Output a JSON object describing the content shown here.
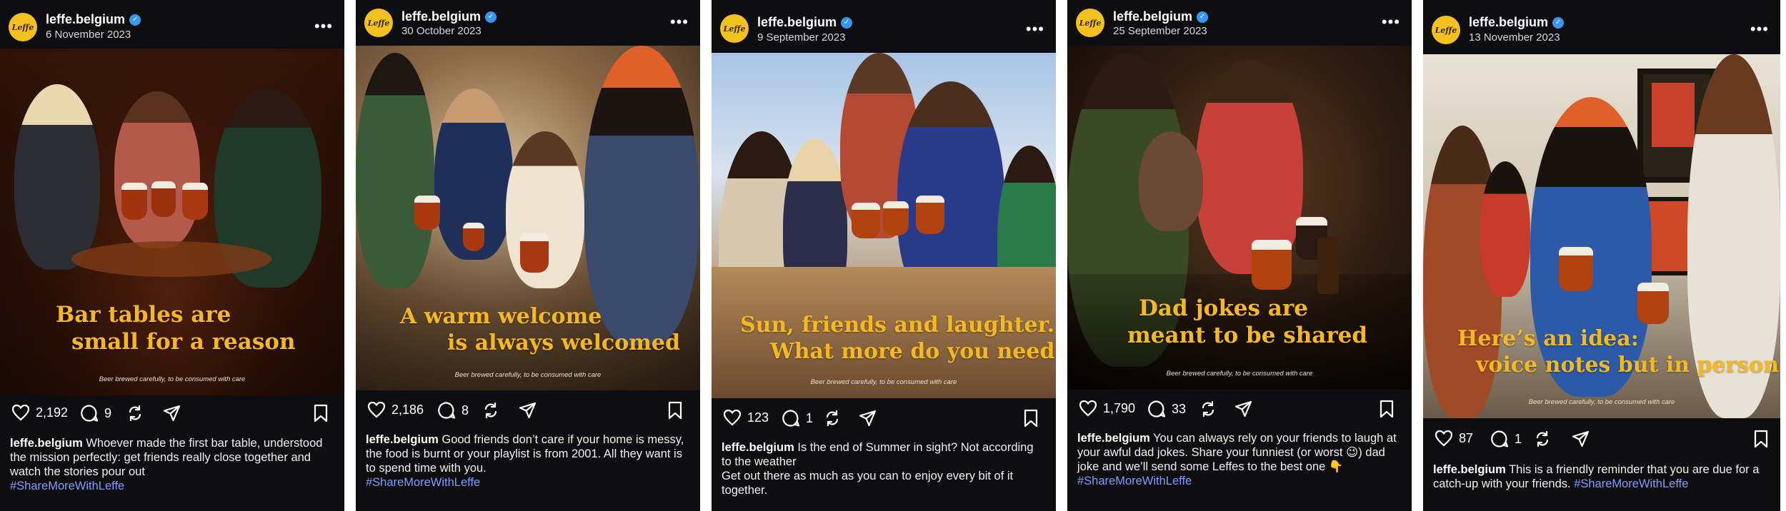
{
  "brand": {
    "avatar_text": "Leffe",
    "verified_mark": "✓",
    "disclaimer": "Beer brewed carefully, to be consumed with care",
    "more_label": "•••",
    "colors": {
      "post_bg": "#0e0e10",
      "headline": "#f6b820",
      "avatar_bg": "#f3c221",
      "hashtag": "#7f9dff",
      "verified": "#3897f0"
    }
  },
  "icons": [
    "heart-icon",
    "comment-icon",
    "repost-icon",
    "share-icon",
    "bookmark-icon",
    "more-icon",
    "verified-badge-icon"
  ],
  "posts": [
    {
      "username": "leffe.belgium",
      "date": "6 November 2023",
      "headline_1": "Bar tables are",
      "headline_2": "small for a reason",
      "likes": "2,192",
      "comments": "9",
      "caption_text": "Whoever made the first bar table, understood the mission perfectly: get friends really close together and watch the stories pour out",
      "caption_text_2": "",
      "hashtag": "#ShareMoreWithLeffe"
    },
    {
      "username": "leffe.belgium",
      "date": "30 October 2023",
      "headline_1": "A warm welcome",
      "headline_2": "is always welcomed",
      "likes": "2,186",
      "comments": "8",
      "caption_text": "Good friends don’t care if your home is messy, the food is burnt or your playlist is from 2001. All they want is to spend time with you.",
      "caption_text_2": "",
      "hashtag": "#ShareMoreWithLeffe"
    },
    {
      "username": "leffe.belgium",
      "date": "9 September 2023",
      "headline_1": "Sun, friends and laughter.",
      "headline_2": "What more do you need?",
      "likes": "123",
      "comments": "1",
      "caption_text": "Is the end of Summer in sight? Not according to the weather",
      "caption_text_2": "Get out there as much as you can to enjoy every bit of it together.",
      "hashtag": ""
    },
    {
      "username": "leffe.belgium",
      "date": "25 September 2023",
      "headline_1": "Dad jokes are",
      "headline_2": "meant to be shared",
      "likes": "1,790",
      "comments": "33",
      "caption_text": "You can always rely on your friends to laugh at your awful dad jokes. Share your funniest (or worst 😉) dad joke and we’ll send some Leffes to the best one 👇",
      "caption_text_2": "",
      "hashtag": "#ShareMoreWithLeffe"
    },
    {
      "username": "leffe.belgium",
      "date": "13 November 2023",
      "headline_1": "Here’s an idea:",
      "headline_2": "voice notes but in person",
      "likes": "87",
      "comments": "1",
      "caption_text": "This is a friendly reminder that you are due for a catch-up with your friends.",
      "caption_text_2": "",
      "hashtag": "#ShareMoreWithLeffe"
    }
  ]
}
